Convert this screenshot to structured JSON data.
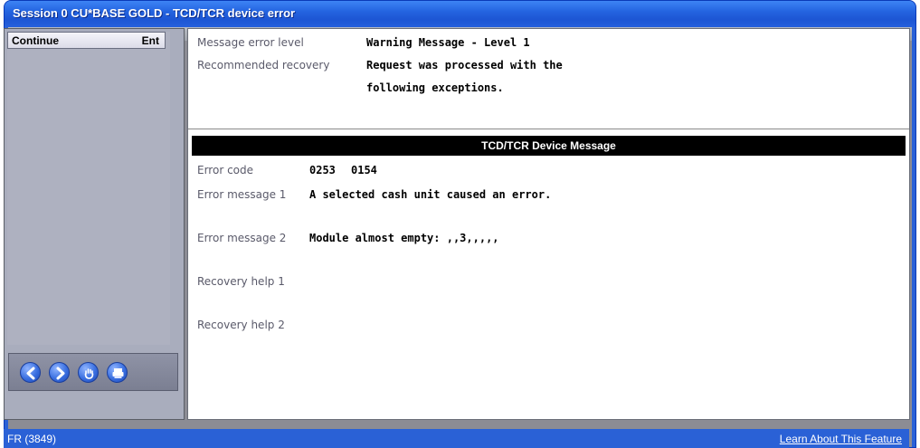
{
  "window": {
    "title": "Session 0 CU*BASE GOLD - TCD/TCR device error"
  },
  "commands": [
    {
      "label": "Continue",
      "key": "Ent"
    }
  ],
  "nav": {
    "buttons": [
      "back-arrow-icon",
      "forward-arrow-icon",
      "stop-hand-icon",
      "print-icon"
    ]
  },
  "header_fields": {
    "error_level_label": "Message error level",
    "error_level_value": "Warning Message - Level 1",
    "recovery_label": "Recommended recovery",
    "recovery_value_line1": "Request was processed with the",
    "recovery_value_line2": "following exceptions."
  },
  "device_section": {
    "title": "TCD/TCR Device Message",
    "error_code_label": "Error code",
    "error_code_value1": "0253",
    "error_code_value2": "0154",
    "error_msg1_label": "Error message 1",
    "error_msg1_value": "A selected cash unit caused an error.",
    "error_msg2_label": "Error message 2",
    "error_msg2_value": "Module almost empty: ,,3,,,,,",
    "recovery1_label": "Recovery help 1",
    "recovery1_value": "",
    "recovery2_label": "Recovery help 2",
    "recovery2_value": ""
  },
  "status": {
    "screen_id": "FR (3849)",
    "learn_link": "Learn About This Feature"
  },
  "colors": {
    "title_bar": "#2464e0",
    "frame": "#2a61d6",
    "section_bar": "#000000"
  }
}
